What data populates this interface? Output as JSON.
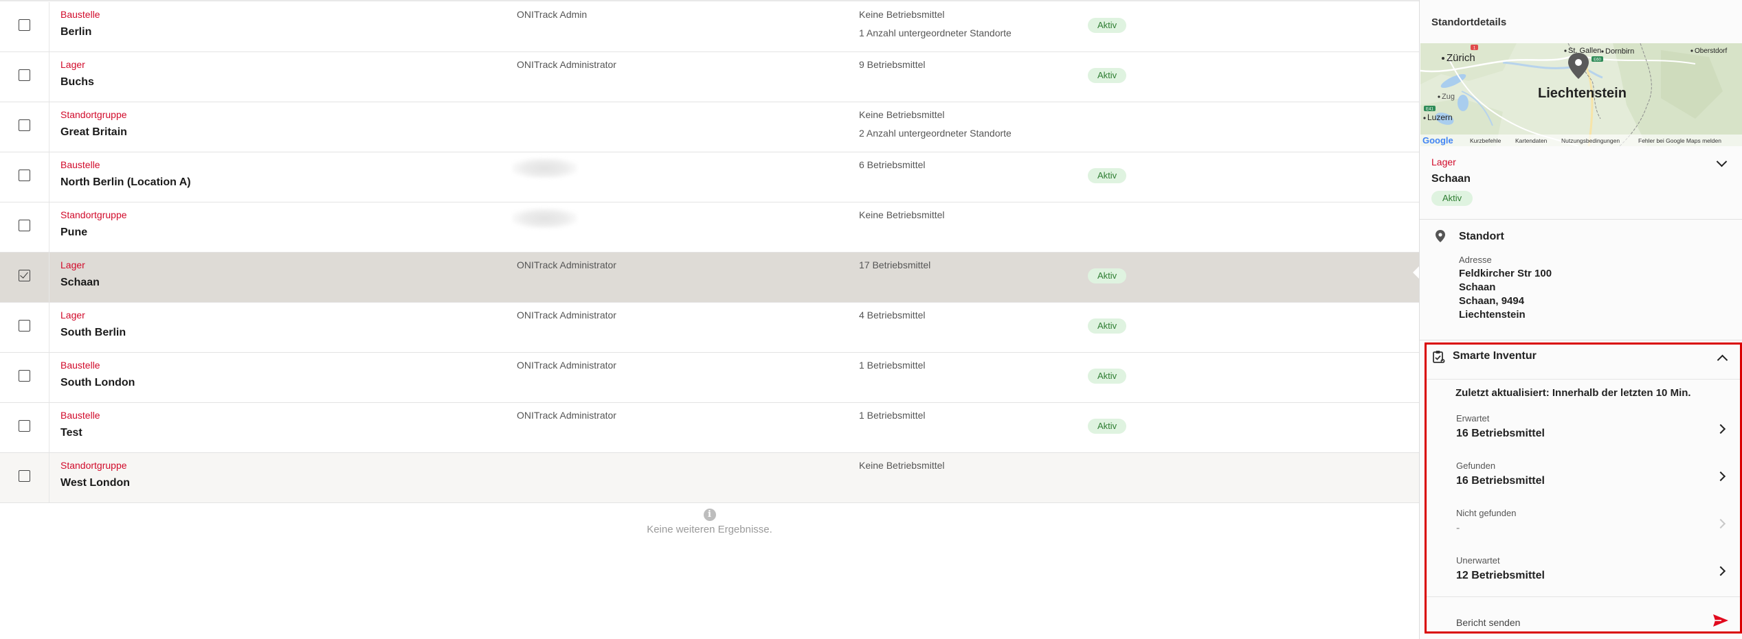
{
  "locations": [
    {
      "type": "Baustelle",
      "name": "Berlin",
      "owner": "ONITrack Admin",
      "owner_blurred": false,
      "assets": "Keine Betriebsmittel",
      "sub": "1 Anzahl untergeordneter Standorte",
      "status": "Aktiv",
      "checked": false,
      "selected": false
    },
    {
      "type": "Lager",
      "name": "Buchs",
      "owner": "ONITrack Administrator",
      "owner_blurred": false,
      "assets": "9 Betriebsmittel",
      "sub": "",
      "status": "Aktiv",
      "checked": false,
      "selected": false
    },
    {
      "type": "Standortgruppe",
      "name": "Great Britain",
      "owner": "",
      "owner_blurred": false,
      "assets": "Keine Betriebsmittel",
      "sub": "2 Anzahl untergeordneter Standorte",
      "status": "",
      "checked": false,
      "selected": false
    },
    {
      "type": "Baustelle",
      "name": "North Berlin (Location A)",
      "owner": "",
      "owner_blurred": true,
      "assets": "6 Betriebsmittel",
      "sub": "",
      "status": "Aktiv",
      "checked": false,
      "selected": false
    },
    {
      "type": "Standortgruppe",
      "name": "Pune",
      "owner": "",
      "owner_blurred": true,
      "assets": "Keine Betriebsmittel",
      "sub": "",
      "status": "",
      "checked": false,
      "selected": false
    },
    {
      "type": "Lager",
      "name": "Schaan",
      "owner": "ONITrack Administrator",
      "owner_blurred": false,
      "assets": "17 Betriebsmittel",
      "sub": "",
      "status": "Aktiv",
      "checked": true,
      "selected": true
    },
    {
      "type": "Lager",
      "name": "South Berlin",
      "owner": "ONITrack Administrator",
      "owner_blurred": false,
      "assets": "4 Betriebsmittel",
      "sub": "",
      "status": "Aktiv",
      "checked": false,
      "selected": false
    },
    {
      "type": "Baustelle",
      "name": "South London",
      "owner": "ONITrack Administrator",
      "owner_blurred": false,
      "assets": "1 Betriebsmittel",
      "sub": "",
      "status": "Aktiv",
      "checked": false,
      "selected": false
    },
    {
      "type": "Baustelle",
      "name": "Test",
      "owner": "ONITrack Administrator",
      "owner_blurred": false,
      "assets": "1 Betriebsmittel",
      "sub": "",
      "status": "Aktiv",
      "checked": false,
      "selected": false
    },
    {
      "type": "Standortgruppe",
      "name": "West London",
      "owner": "",
      "owner_blurred": false,
      "assets": "Keine Betriebsmittel",
      "sub": "",
      "status": "",
      "checked": false,
      "selected": false
    }
  ],
  "list_footer": {
    "text": "Keine weiteren Ergebnisse."
  },
  "panel": {
    "title": "Standortdetails",
    "map": {
      "labels": [
        "Zürich",
        "St. Gallen",
        "Dornbirn",
        "Oberstdorf",
        "Zug",
        "Liechtenstein",
        "Luzern"
      ],
      "road_badges": [
        "1",
        "E60",
        "E41"
      ],
      "footer": [
        "Kurzbefehle",
        "Kartendaten",
        "Nutzungsbedingungen",
        "Fehler bei Google Maps melden"
      ],
      "logo": "Google"
    },
    "location": {
      "type": "Lager",
      "name": "Schaan",
      "status": "Aktiv"
    },
    "address": {
      "heading": "Standort",
      "label": "Adresse",
      "line1": "Feldkircher Str 100",
      "line2": "Schaan",
      "line3": "Schaan, 9494",
      "line4": "Liechtenstein"
    },
    "smart_inventory": {
      "title": "Smarte Inventur",
      "updated": "Zuletzt aktualisiert: Innerhalb der letzten 10 Min.",
      "metrics": [
        {
          "label": "Erwartet",
          "value": "16 Betriebsmittel",
          "enabled": true
        },
        {
          "label": "Gefunden",
          "value": "16 Betriebsmittel",
          "enabled": true
        },
        {
          "label": "Nicht gefunden",
          "value": "-",
          "enabled": false
        },
        {
          "label": "Unerwartet",
          "value": "12 Betriebsmittel",
          "enabled": true
        }
      ],
      "send_report": "Bericht senden"
    }
  },
  "colors": {
    "type_red": "#d10a2a",
    "status_bg": "#dff3e0",
    "status_fg": "#2e7d32",
    "highlight_border": "#d90000",
    "selected_row": "#dedbd6"
  }
}
